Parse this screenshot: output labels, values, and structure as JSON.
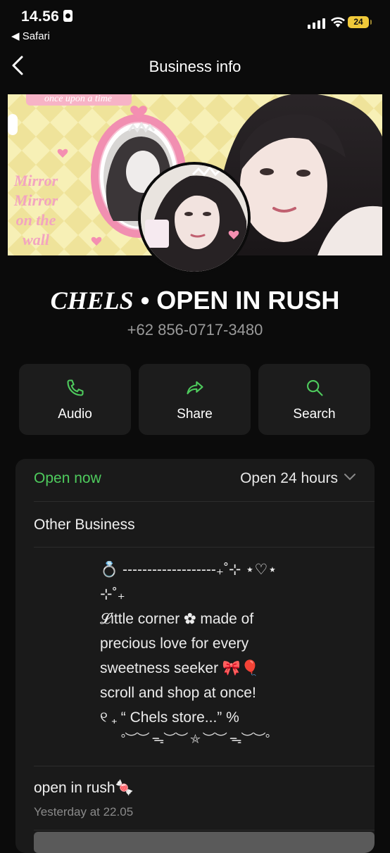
{
  "status_bar": {
    "time": "14.56",
    "back_app": "◀ Safari",
    "battery": "24"
  },
  "nav": {
    "title": "Business info"
  },
  "profile": {
    "name_styled": "CHELS",
    "name_rest": " • OPEN IN RUSH",
    "phone": "+62 856-0717-3480",
    "cover_text_1": "once upon a time",
    "cover_text_2": "Mirror Mirror on the wall"
  },
  "actions": [
    {
      "label": "Audio",
      "icon": "phone-icon"
    },
    {
      "label": "Share",
      "icon": "share-icon"
    },
    {
      "label": "Search",
      "icon": "search-icon"
    }
  ],
  "info": {
    "open_status": "Open now",
    "hours": "Open 24 hours",
    "category": "Other Business",
    "description": "💍 ‐‐‐‐‐‐‐‐‐‐‐‐‐‐‐‐‐‐‐₊˚⊹ ⋆♡⋆ ⊹˚₊\n𝓛ittle corner ✿ made of\nprecious  love  for every\nsweetness seeker 🎀🎈\nscroll and shop at once!\n୧ ₊ “ Chels store...” %",
    "divider": "°︶︶ ᯓ︶︶ ⛤ ︶︶ ᯓ︶︶°"
  },
  "post": {
    "title": "open in rush🍬",
    "time": "Yesterday at 22.05"
  },
  "colors": {
    "accent_green": "#4ecb5d",
    "background": "#0b0b0b",
    "card": "#1a1a1a"
  }
}
